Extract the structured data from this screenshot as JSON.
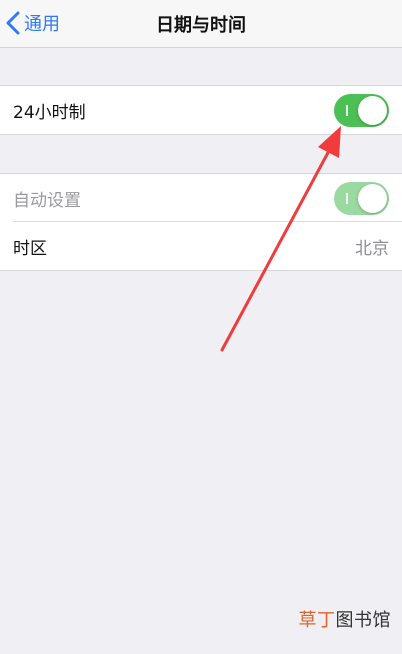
{
  "navbar": {
    "back_label": "通用",
    "title": "日期与时间"
  },
  "settings": {
    "hour24": {
      "label": "24小时制",
      "on": true
    },
    "auto_set": {
      "label": "自动设置",
      "on": true,
      "enabled": false
    },
    "timezone": {
      "label": "时区",
      "value": "北京"
    }
  },
  "watermark": {
    "part1": "草丁",
    "part2": "图书馆"
  },
  "colors": {
    "accent_blue": "#2f7bf6",
    "toggle_green": "#4cc054",
    "toggle_green_disabled": "#9ad9a0",
    "annotation_arrow": "#f03c3c",
    "background": "#efeff4"
  }
}
